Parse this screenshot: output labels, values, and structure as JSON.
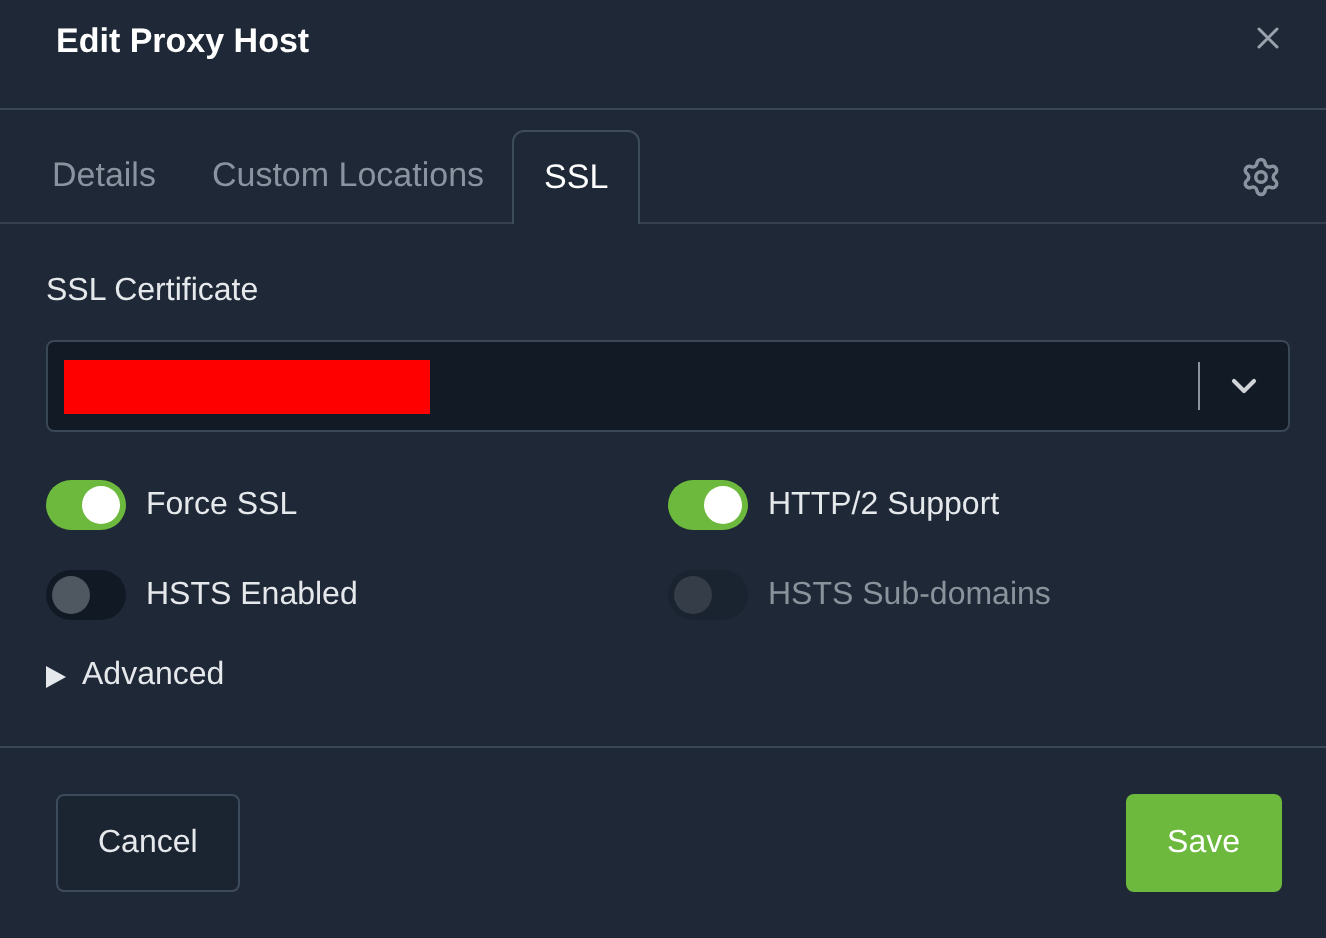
{
  "dialog": {
    "title": "Edit Proxy Host"
  },
  "tabs": [
    {
      "label": "Details",
      "selected": false
    },
    {
      "label": "Custom Locations",
      "selected": false
    },
    {
      "label": "SSL",
      "selected": true
    }
  ],
  "ssl_certificate": {
    "label": "SSL Certificate",
    "value_redacted": true
  },
  "toggles": [
    {
      "label": "Force SSL",
      "on": true,
      "disabled": false
    },
    {
      "label": "HTTP/2 Support",
      "on": true,
      "disabled": false
    },
    {
      "label": "HSTS Enabled",
      "on": false,
      "disabled": false
    },
    {
      "label": "HSTS Sub-domains",
      "on": false,
      "disabled": true
    }
  ],
  "advanced": {
    "label": "Advanced",
    "expanded": false
  },
  "buttons": [
    {
      "label": "Cancel",
      "kind": "secondary"
    },
    {
      "label": "Save",
      "kind": "primary"
    }
  ]
}
